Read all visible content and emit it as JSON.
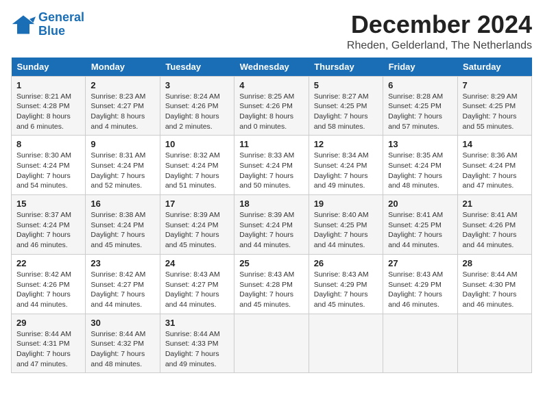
{
  "header": {
    "logo_line1": "General",
    "logo_line2": "Blue",
    "month": "December 2024",
    "location": "Rheden, Gelderland, The Netherlands"
  },
  "days_of_week": [
    "Sunday",
    "Monday",
    "Tuesday",
    "Wednesday",
    "Thursday",
    "Friday",
    "Saturday"
  ],
  "weeks": [
    [
      {
        "day": "1",
        "sunrise": "Sunrise: 8:21 AM",
        "sunset": "Sunset: 4:28 PM",
        "daylight": "Daylight: 8 hours and 6 minutes."
      },
      {
        "day": "2",
        "sunrise": "Sunrise: 8:23 AM",
        "sunset": "Sunset: 4:27 PM",
        "daylight": "Daylight: 8 hours and 4 minutes."
      },
      {
        "day": "3",
        "sunrise": "Sunrise: 8:24 AM",
        "sunset": "Sunset: 4:26 PM",
        "daylight": "Daylight: 8 hours and 2 minutes."
      },
      {
        "day": "4",
        "sunrise": "Sunrise: 8:25 AM",
        "sunset": "Sunset: 4:26 PM",
        "daylight": "Daylight: 8 hours and 0 minutes."
      },
      {
        "day": "5",
        "sunrise": "Sunrise: 8:27 AM",
        "sunset": "Sunset: 4:25 PM",
        "daylight": "Daylight: 7 hours and 58 minutes."
      },
      {
        "day": "6",
        "sunrise": "Sunrise: 8:28 AM",
        "sunset": "Sunset: 4:25 PM",
        "daylight": "Daylight: 7 hours and 57 minutes."
      },
      {
        "day": "7",
        "sunrise": "Sunrise: 8:29 AM",
        "sunset": "Sunset: 4:25 PM",
        "daylight": "Daylight: 7 hours and 55 minutes."
      }
    ],
    [
      {
        "day": "8",
        "sunrise": "Sunrise: 8:30 AM",
        "sunset": "Sunset: 4:24 PM",
        "daylight": "Daylight: 7 hours and 54 minutes."
      },
      {
        "day": "9",
        "sunrise": "Sunrise: 8:31 AM",
        "sunset": "Sunset: 4:24 PM",
        "daylight": "Daylight: 7 hours and 52 minutes."
      },
      {
        "day": "10",
        "sunrise": "Sunrise: 8:32 AM",
        "sunset": "Sunset: 4:24 PM",
        "daylight": "Daylight: 7 hours and 51 minutes."
      },
      {
        "day": "11",
        "sunrise": "Sunrise: 8:33 AM",
        "sunset": "Sunset: 4:24 PM",
        "daylight": "Daylight: 7 hours and 50 minutes."
      },
      {
        "day": "12",
        "sunrise": "Sunrise: 8:34 AM",
        "sunset": "Sunset: 4:24 PM",
        "daylight": "Daylight: 7 hours and 49 minutes."
      },
      {
        "day": "13",
        "sunrise": "Sunrise: 8:35 AM",
        "sunset": "Sunset: 4:24 PM",
        "daylight": "Daylight: 7 hours and 48 minutes."
      },
      {
        "day": "14",
        "sunrise": "Sunrise: 8:36 AM",
        "sunset": "Sunset: 4:24 PM",
        "daylight": "Daylight: 7 hours and 47 minutes."
      }
    ],
    [
      {
        "day": "15",
        "sunrise": "Sunrise: 8:37 AM",
        "sunset": "Sunset: 4:24 PM",
        "daylight": "Daylight: 7 hours and 46 minutes."
      },
      {
        "day": "16",
        "sunrise": "Sunrise: 8:38 AM",
        "sunset": "Sunset: 4:24 PM",
        "daylight": "Daylight: 7 hours and 45 minutes."
      },
      {
        "day": "17",
        "sunrise": "Sunrise: 8:39 AM",
        "sunset": "Sunset: 4:24 PM",
        "daylight": "Daylight: 7 hours and 45 minutes."
      },
      {
        "day": "18",
        "sunrise": "Sunrise: 8:39 AM",
        "sunset": "Sunset: 4:24 PM",
        "daylight": "Daylight: 7 hours and 44 minutes."
      },
      {
        "day": "19",
        "sunrise": "Sunrise: 8:40 AM",
        "sunset": "Sunset: 4:25 PM",
        "daylight": "Daylight: 7 hours and 44 minutes."
      },
      {
        "day": "20",
        "sunrise": "Sunrise: 8:41 AM",
        "sunset": "Sunset: 4:25 PM",
        "daylight": "Daylight: 7 hours and 44 minutes."
      },
      {
        "day": "21",
        "sunrise": "Sunrise: 8:41 AM",
        "sunset": "Sunset: 4:26 PM",
        "daylight": "Daylight: 7 hours and 44 minutes."
      }
    ],
    [
      {
        "day": "22",
        "sunrise": "Sunrise: 8:42 AM",
        "sunset": "Sunset: 4:26 PM",
        "daylight": "Daylight: 7 hours and 44 minutes."
      },
      {
        "day": "23",
        "sunrise": "Sunrise: 8:42 AM",
        "sunset": "Sunset: 4:27 PM",
        "daylight": "Daylight: 7 hours and 44 minutes."
      },
      {
        "day": "24",
        "sunrise": "Sunrise: 8:43 AM",
        "sunset": "Sunset: 4:27 PM",
        "daylight": "Daylight: 7 hours and 44 minutes."
      },
      {
        "day": "25",
        "sunrise": "Sunrise: 8:43 AM",
        "sunset": "Sunset: 4:28 PM",
        "daylight": "Daylight: 7 hours and 45 minutes."
      },
      {
        "day": "26",
        "sunrise": "Sunrise: 8:43 AM",
        "sunset": "Sunset: 4:29 PM",
        "daylight": "Daylight: 7 hours and 45 minutes."
      },
      {
        "day": "27",
        "sunrise": "Sunrise: 8:43 AM",
        "sunset": "Sunset: 4:29 PM",
        "daylight": "Daylight: 7 hours and 46 minutes."
      },
      {
        "day": "28",
        "sunrise": "Sunrise: 8:44 AM",
        "sunset": "Sunset: 4:30 PM",
        "daylight": "Daylight: 7 hours and 46 minutes."
      }
    ],
    [
      {
        "day": "29",
        "sunrise": "Sunrise: 8:44 AM",
        "sunset": "Sunset: 4:31 PM",
        "daylight": "Daylight: 7 hours and 47 minutes."
      },
      {
        "day": "30",
        "sunrise": "Sunrise: 8:44 AM",
        "sunset": "Sunset: 4:32 PM",
        "daylight": "Daylight: 7 hours and 48 minutes."
      },
      {
        "day": "31",
        "sunrise": "Sunrise: 8:44 AM",
        "sunset": "Sunset: 4:33 PM",
        "daylight": "Daylight: 7 hours and 49 minutes."
      },
      null,
      null,
      null,
      null
    ]
  ],
  "colors": {
    "header_bg": "#1a6eb5",
    "header_text": "#ffffff",
    "logo_blue": "#1a6eb5"
  }
}
